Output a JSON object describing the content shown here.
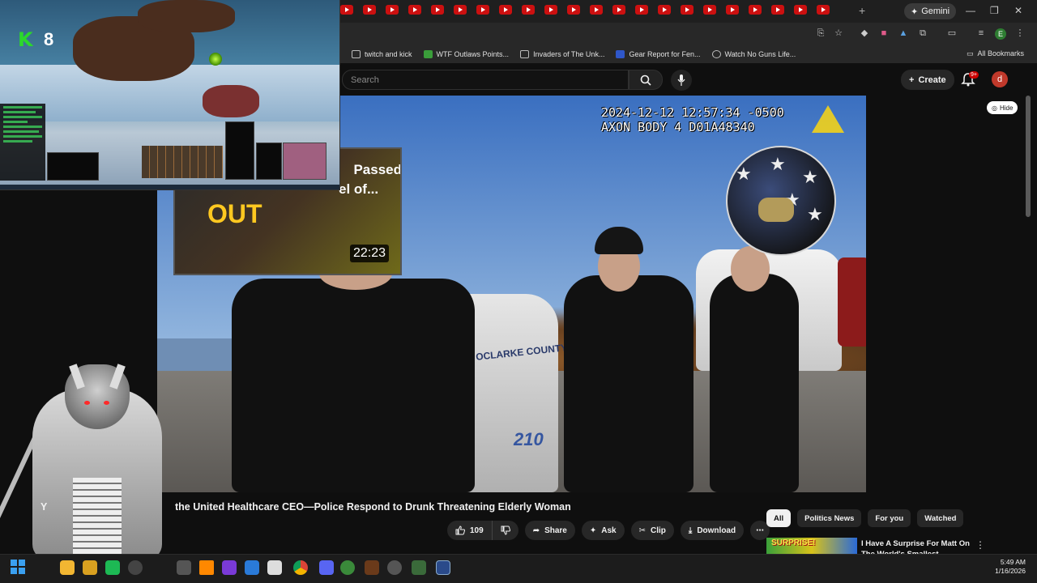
{
  "browser": {
    "gemini_label": "Gemini",
    "new_tab_symbol": "+",
    "bookmarks": [
      {
        "label": "twitch and kick",
        "icon": "folder-icon"
      },
      {
        "label": "WTF Outlaws Points...",
        "icon": "sheets-icon"
      },
      {
        "label": "Invaders of The Unk...",
        "icon": "bookmark-icon"
      },
      {
        "label": "Gear Report for Fen...",
        "icon": "wow-icon"
      },
      {
        "label": "Watch No Guns Life...",
        "icon": "gear-icon"
      }
    ],
    "all_bookmarks_label": "All Bookmarks",
    "profile_initial": "E"
  },
  "youtube": {
    "search_placeholder": "Search",
    "create_label": "Create",
    "notification_badge": "9+",
    "avatar_initial": "d",
    "hide_label": "Hide"
  },
  "video": {
    "bodycam_line1": "2024-12-12 12:57:34 -0500",
    "bodycam_line2": "AXON BODY 4 D01A48340",
    "car_number": "210",
    "county_text": "OCLARKE COUNTY",
    "title_prefix": "Y",
    "title": "the United Healthcare CEO—Police Respond to Drunk Threatening Elderly Woman",
    "like_count": "109",
    "actions": {
      "share": "Share",
      "ask": "Ask",
      "clip": "Clip",
      "download": "Download"
    }
  },
  "suggested": {
    "title_line1": "Passed",
    "title_line2": "el of...",
    "out_label": "OUT",
    "duration": "22:23"
  },
  "game": {
    "key_letter": "K",
    "key_number": "8"
  },
  "sidebar": {
    "chips": [
      "All",
      "Politics News",
      "For you",
      "Watched"
    ],
    "active_chip": "All",
    "rec_thumb_text": "SURPRISE!",
    "rec_title": "I Have A Surprise For Matt On The World's Smallest Offroad..."
  },
  "taskbar": {
    "time": "5:49 AM",
    "date": "1/16/2026"
  },
  "colors": {
    "youtube_red": "#cc0000",
    "accent_green": "#2bd82b",
    "background": "#0f0f0f"
  }
}
